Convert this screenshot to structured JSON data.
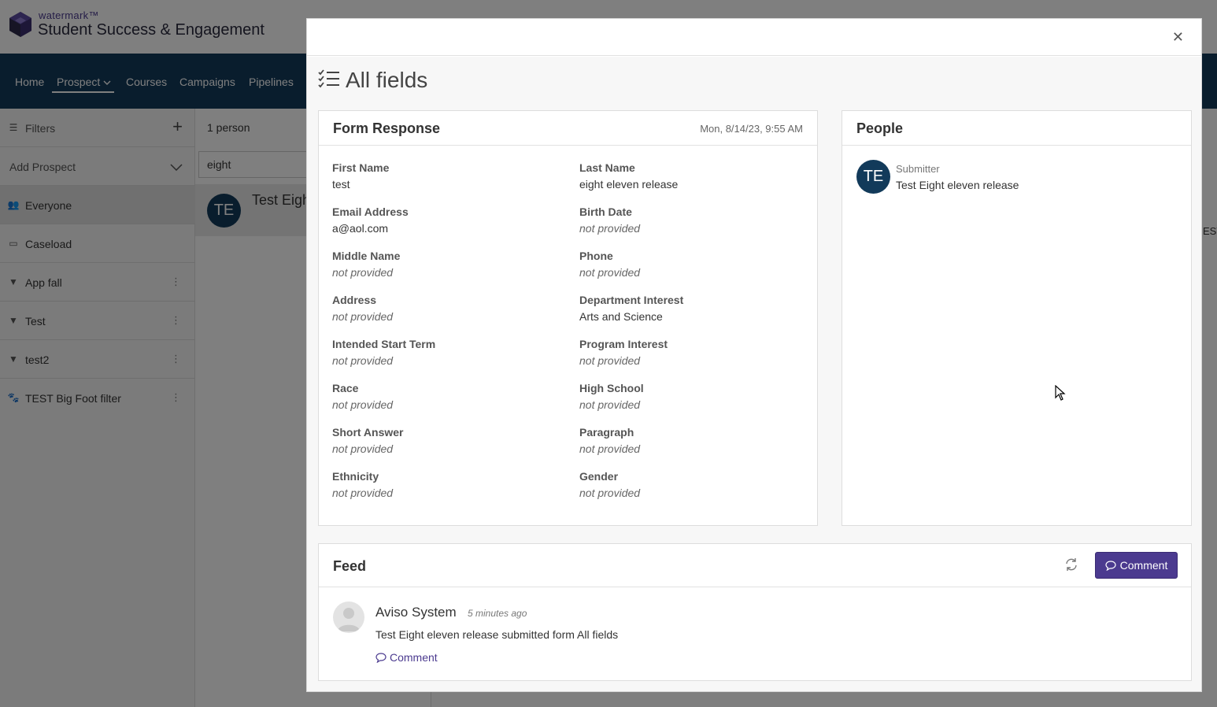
{
  "app": {
    "brand_small": "watermark™",
    "brand_title": "Student Success & Engagement"
  },
  "nav": {
    "items": [
      "Home",
      "Prospect",
      "Courses",
      "Campaigns",
      "Pipelines"
    ],
    "active": "Prospect"
  },
  "sidebar": {
    "filters_label": "Filters",
    "add_prospect": "Add Prospect",
    "items": [
      {
        "label": "Everyone",
        "icon": "users-icon"
      },
      {
        "label": "Caseload",
        "icon": "briefcase-icon"
      },
      {
        "label": "App fall",
        "icon": "filter-icon"
      },
      {
        "label": "Test",
        "icon": "filter-icon"
      },
      {
        "label": "test2",
        "icon": "filter-icon"
      },
      {
        "label": "TEST Big Foot filter",
        "icon": "paw-icon"
      }
    ]
  },
  "list": {
    "count": "1 person",
    "search_value": "eight",
    "person": {
      "initials": "TE",
      "name": "Test Eigh"
    }
  },
  "background_right_text": "EST",
  "modal": {
    "title": "All fields",
    "form_response": {
      "heading": "Form Response",
      "date": "Mon, 8/14/23, 9:55 AM",
      "fields": [
        {
          "label": "First Name",
          "value": "test",
          "provided": true
        },
        {
          "label": "Last Name",
          "value": "eight eleven release",
          "provided": true
        },
        {
          "label": "Email Address",
          "value": "a@aol.com",
          "provided": true
        },
        {
          "label": "Birth Date",
          "value": "not provided",
          "provided": false
        },
        {
          "label": "Middle Name",
          "value": "not provided",
          "provided": false
        },
        {
          "label": "Phone",
          "value": "not provided",
          "provided": false
        },
        {
          "label": "Address",
          "value": "not provided",
          "provided": false
        },
        {
          "label": "Department Interest",
          "value": "Arts and Science",
          "provided": true
        },
        {
          "label": "Intended Start Term",
          "value": "not provided",
          "provided": false
        },
        {
          "label": "Program Interest",
          "value": "not provided",
          "provided": false
        },
        {
          "label": "Race",
          "value": "not provided",
          "provided": false
        },
        {
          "label": "High School",
          "value": "not provided",
          "provided": false
        },
        {
          "label": "Short Answer",
          "value": "not provided",
          "provided": false
        },
        {
          "label": "Paragraph",
          "value": "not provided",
          "provided": false
        },
        {
          "label": "Ethnicity",
          "value": "not provided",
          "provided": false
        },
        {
          "label": "Gender",
          "value": "not provided",
          "provided": false
        }
      ]
    },
    "people": {
      "heading": "People",
      "initials": "TE",
      "role": "Submitter",
      "name": "Test Eight eleven release"
    },
    "feed": {
      "heading": "Feed",
      "comment_button": "Comment",
      "entry": {
        "author": "Aviso System",
        "time": "5 minutes ago",
        "message": "Test Eight eleven release submitted form All fields",
        "comment_link": "Comment"
      }
    }
  },
  "colors": {
    "navbar": "#123a5a",
    "accent": "#4b3a8f",
    "avatar": "#123a5a"
  }
}
